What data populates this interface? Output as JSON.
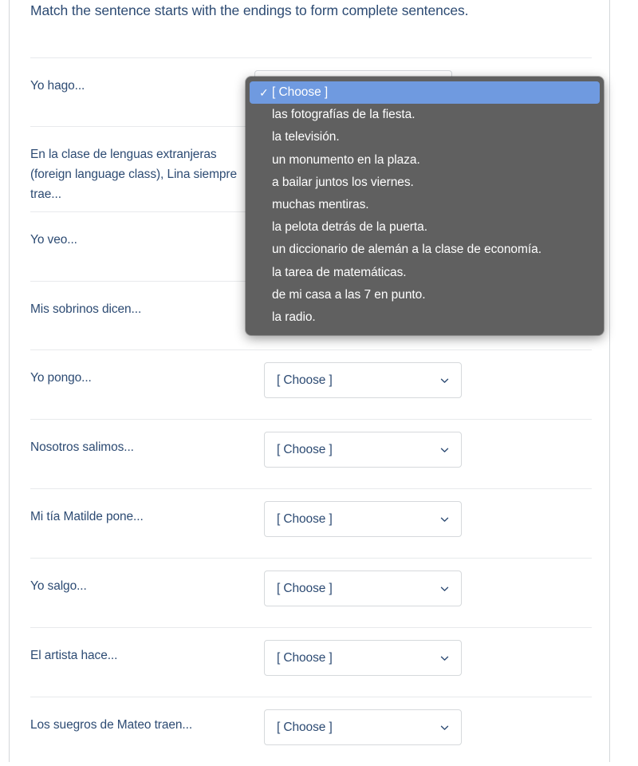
{
  "question": {
    "prompt": "Match the sentence starts with the endings to form complete sentences."
  },
  "select": {
    "placeholder": "[ Choose ]",
    "chevron_icon": "chevron-down-icon"
  },
  "rows": [
    {
      "label": "Yo hago...",
      "value": "[ Choose ]"
    },
    {
      "label": "En la clase de lenguas extranjeras (foreign language class), Lina siempre trae...",
      "value": "[ Choose ]"
    },
    {
      "label": "Yo veo...",
      "value": "[ Choose ]"
    },
    {
      "label": "Mis sobrinos dicen...",
      "value": "[ Choose ]"
    },
    {
      "label": "Yo pongo...",
      "value": "[ Choose ]"
    },
    {
      "label": "Nosotros salimos...",
      "value": "[ Choose ]"
    },
    {
      "label": "Mi tía Matilde pone...",
      "value": "[ Choose ]"
    },
    {
      "label": "Yo salgo...",
      "value": "[ Choose ]"
    },
    {
      "label": "El artista hace...",
      "value": "[ Choose ]"
    },
    {
      "label": "Los suegros de Mateo traen...",
      "value": "[ Choose ]"
    }
  ],
  "dropdown": {
    "open_for_row": 0,
    "checkmark": "✓",
    "selected_index": 0,
    "options": [
      "[ Choose ]",
      "las fotografías de la fiesta.",
      "la televisión.",
      "un monumento en la plaza.",
      "a bailar juntos los viernes.",
      "muchas mentiras.",
      "la pelota detrás de la puerta.",
      "un diccionario de alemán a la clase de economía.",
      "la tarea de matemáticas.",
      "de mi casa a las 7 en punto.",
      "la radio."
    ]
  },
  "colors": {
    "text": "#2d4b73",
    "highlight": "#6f9ae0",
    "popup_bg": "#606060",
    "divider": "#e8eaec",
    "frame_border": "#d4d7da"
  }
}
